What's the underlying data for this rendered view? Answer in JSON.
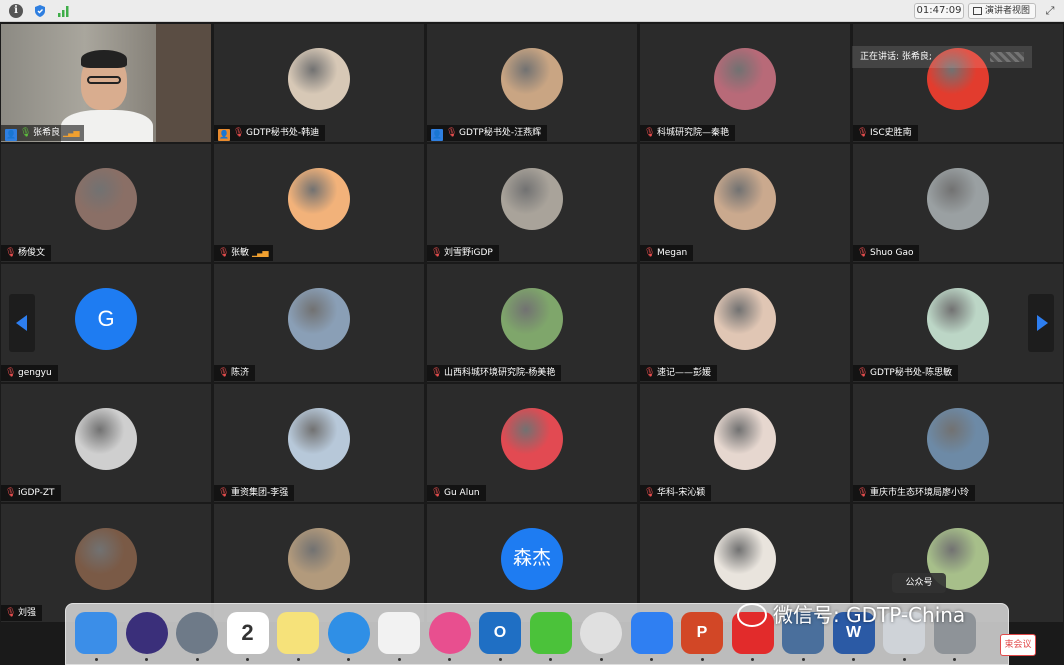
{
  "topbar": {
    "timer": "01:47:09",
    "speaker_view_label": "演讲者视图"
  },
  "speaking_now": "正在讲话: 张希良;",
  "tiles": [
    {
      "name": "张希良",
      "host": true,
      "mic": "on",
      "level": true,
      "video": true
    },
    {
      "name": "GDTP秘书处-韩迪",
      "host": true,
      "host_color": "orange",
      "avatar_color": "#d7c8b6"
    },
    {
      "name": "GDTP秘书处-汪燕辉",
      "host": true,
      "avatar_color": "#c9a583"
    },
    {
      "name": "科城研究院—秦艳",
      "avatar_color": "#b86a78"
    },
    {
      "name": "ISC史胜南",
      "avatar_color": "#e23c2e"
    },
    {
      "name": "杨俊文",
      "avatar_color": "#8a6f66"
    },
    {
      "name": "张敏",
      "level": true,
      "avatar_color": "#f2b27a"
    },
    {
      "name": "刘雪野iGDP",
      "avatar_color": "#a9a39a"
    },
    {
      "name": "Megan",
      "avatar_color": "#caa98e"
    },
    {
      "name": "Shuo Gao",
      "avatar_color": "#9aa0a2"
    },
    {
      "name": "gengyu",
      "avatar_letter": "G"
    },
    {
      "name": "陈济",
      "avatar_color": "#8a9fb6"
    },
    {
      "name": "山西科城环境研究院-杨美艳",
      "avatar_color": "#7fa66b"
    },
    {
      "name": "速记——彭媛",
      "avatar_color": "#e0c6b4"
    },
    {
      "name": "GDTP秘书处-陈思敏",
      "avatar_color": "#bcd6c6"
    },
    {
      "name": "iGDP-ZT",
      "avatar_color": "#cfcfcf"
    },
    {
      "name": "重资集团-李强",
      "avatar_color": "#b7c8d9"
    },
    {
      "name": "Gu Alun",
      "avatar_color": "#e24a52"
    },
    {
      "name": "华科-宋沁颖",
      "avatar_color": "#e6d7cf"
    },
    {
      "name": "重庆市生态环境局廖小玲",
      "avatar_color": "#6d8aa6"
    },
    {
      "name": "刘强",
      "avatar_color": "#7a5a46"
    },
    {
      "name": "",
      "avatar_color": "#b29a7c"
    },
    {
      "name": "",
      "avatar_letter": "森杰"
    },
    {
      "name": "",
      "avatar_color": "#e9e4dd"
    },
    {
      "name": "",
      "avatar_color": "#a7bf8a"
    }
  ],
  "dock": {
    "tooltip": "公众号",
    "items": [
      {
        "id": "finder",
        "color": "#3b8ee8"
      },
      {
        "id": "siri",
        "color": "#3a2f7a"
      },
      {
        "id": "launchpad",
        "color": "#6e7a88"
      },
      {
        "id": "calendar",
        "color": "#ffffff",
        "glyph": "2"
      },
      {
        "id": "notes",
        "color": "#f6e27a"
      },
      {
        "id": "safari",
        "color": "#2f8fe6"
      },
      {
        "id": "numbers",
        "color": "#f2f2f2"
      },
      {
        "id": "itunes",
        "color": "#e84f8f"
      },
      {
        "id": "outlook",
        "color": "#1f6fc4",
        "glyph": "O"
      },
      {
        "id": "wechat",
        "color": "#4bc23a"
      },
      {
        "id": "chrome",
        "color": "#e0e0e0"
      },
      {
        "id": "lark",
        "color": "#2f7ff2"
      },
      {
        "id": "powerpoint",
        "color": "#d24726",
        "glyph": "P"
      },
      {
        "id": "acrobat",
        "color": "#e22b2b"
      },
      {
        "id": "keynote",
        "color": "#4a6f9c"
      },
      {
        "id": "word",
        "color": "#2b5aa5",
        "glyph": "W"
      },
      {
        "id": "preview",
        "color": "#cfd3d8"
      },
      {
        "id": "trash",
        "color": "#8e9398"
      }
    ]
  },
  "watermark": "微信号: GDTP-China",
  "end_meeting_label": "束会议"
}
